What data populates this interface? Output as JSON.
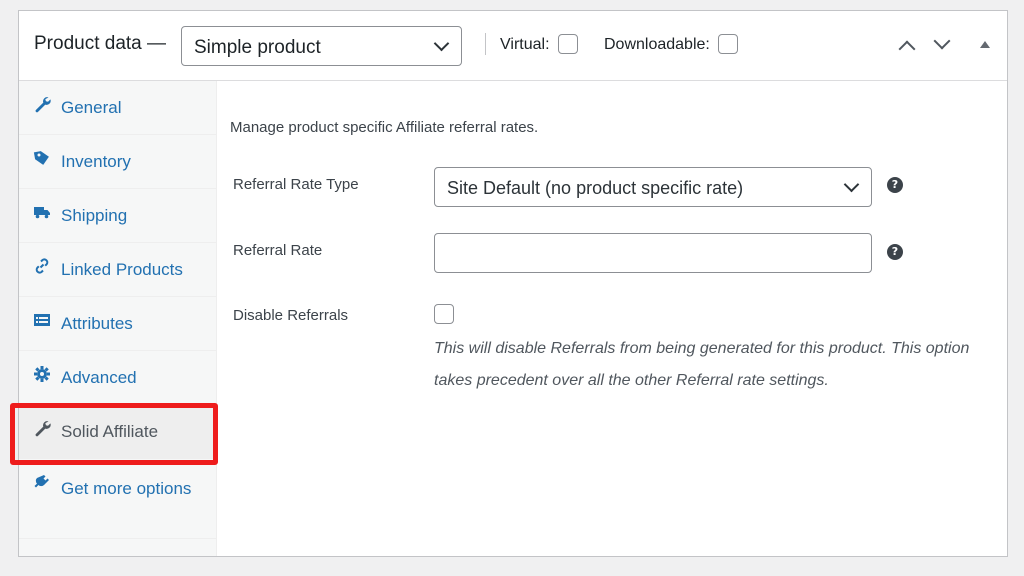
{
  "header": {
    "title": "Product data —",
    "product_type": "Simple product",
    "virtual_label": "Virtual:",
    "downloadable_label": "Downloadable:"
  },
  "sidebar": {
    "items": [
      {
        "label": "General",
        "icon": "wrench-icon"
      },
      {
        "label": "Inventory",
        "icon": "tag-icon"
      },
      {
        "label": "Shipping",
        "icon": "truck-icon"
      },
      {
        "label": "Linked Products",
        "icon": "link-icon"
      },
      {
        "label": "Attributes",
        "icon": "list-icon"
      },
      {
        "label": "Advanced",
        "icon": "gear-icon"
      },
      {
        "label": "Solid Affiliate",
        "icon": "wrench-icon",
        "active": true
      },
      {
        "label": "Get more options",
        "icon": "plugin-icon"
      }
    ]
  },
  "main": {
    "intro": "Manage product specific Affiliate referral rates.",
    "rate_type_label": "Referral Rate Type",
    "rate_type_value": "Site Default (no product specific rate)",
    "rate_label": "Referral Rate",
    "rate_value": "",
    "disable_label": "Disable Referrals",
    "disable_description": "This will disable Referrals from being generated for this product. This option takes precedent over all the other Referral rate settings."
  },
  "colors": {
    "link": "#2271b1",
    "highlight": "#ee1c1c"
  }
}
